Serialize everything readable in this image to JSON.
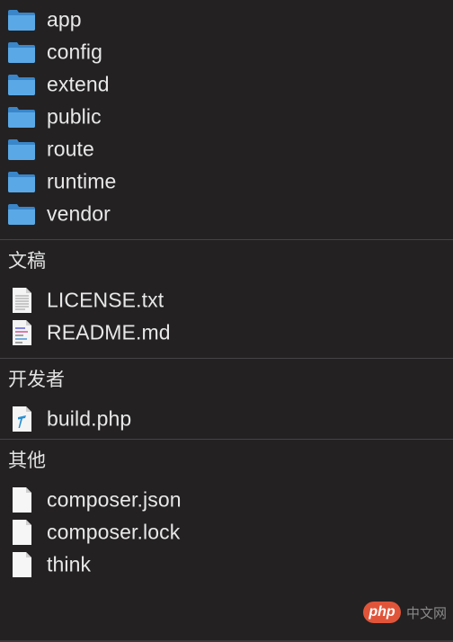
{
  "folders": [
    {
      "name": "app"
    },
    {
      "name": "config"
    },
    {
      "name": "extend"
    },
    {
      "name": "public"
    },
    {
      "name": "route"
    },
    {
      "name": "runtime"
    },
    {
      "name": "vendor"
    }
  ],
  "sections": {
    "documents": {
      "title": "文稿",
      "items": [
        {
          "name": "LICENSE.txt",
          "icon": "text-document-icon"
        },
        {
          "name": "README.md",
          "icon": "markdown-document-icon"
        }
      ]
    },
    "developer": {
      "title": "开发者",
      "items": [
        {
          "name": "build.php",
          "icon": "php-script-icon"
        }
      ]
    },
    "other": {
      "title": "其他",
      "items": [
        {
          "name": "composer.json",
          "icon": "blank-document-icon"
        },
        {
          "name": "composer.lock",
          "icon": "blank-document-icon"
        },
        {
          "name": "think",
          "icon": "blank-document-icon"
        }
      ]
    }
  },
  "watermark": {
    "badge": "php",
    "text": "中文网"
  },
  "colors": {
    "background": "#232122",
    "folder": "#3d8fd6",
    "divider": "#454345",
    "text": "#e8e8e8"
  }
}
